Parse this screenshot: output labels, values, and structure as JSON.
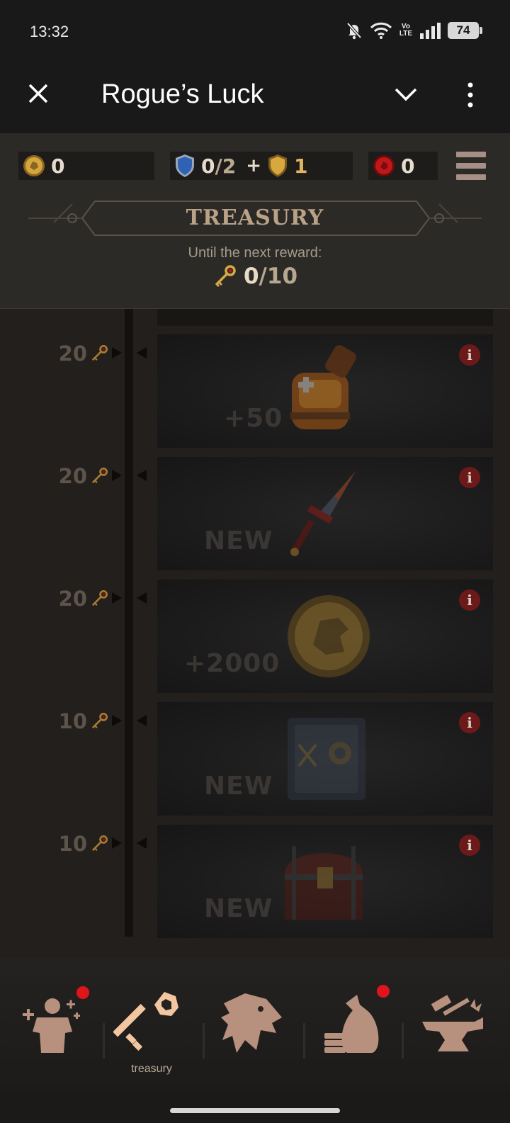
{
  "status_bar": {
    "time": "13:32",
    "network_label_top": "Vo",
    "network_label_bottom": "LTE",
    "battery": "74"
  },
  "app_bar": {
    "title": "Rogue’s Luck"
  },
  "resources": {
    "coins": "0",
    "shields_current": "0",
    "shields_total": "/2",
    "plus": "+",
    "gold_shields": "1",
    "gems": "0"
  },
  "treasury": {
    "title": "TREASURY",
    "until_text": "Until the next reward:",
    "keys_current": "0",
    "keys_total": "/10"
  },
  "rewards": [
    {
      "cost": "20",
      "label": "+50",
      "item": "potion",
      "info": "i"
    },
    {
      "cost": "20",
      "label": "NEW",
      "item": "dagger",
      "info": "i"
    },
    {
      "cost": "20",
      "label": "+2000",
      "item": "coin",
      "info": "i"
    },
    {
      "cost": "10",
      "label": "NEW",
      "item": "safe",
      "info": "i"
    },
    {
      "cost": "10",
      "label": "NEW",
      "item": "chest",
      "info": "i"
    }
  ],
  "nav": {
    "heroes_label": "",
    "treasury_label": "treasury",
    "guild_label": "",
    "shop_label": "",
    "forge_label": ""
  },
  "colors": {
    "accent_red": "#e0141b",
    "gold": "#e0b560",
    "panel": "#2c2a27"
  }
}
